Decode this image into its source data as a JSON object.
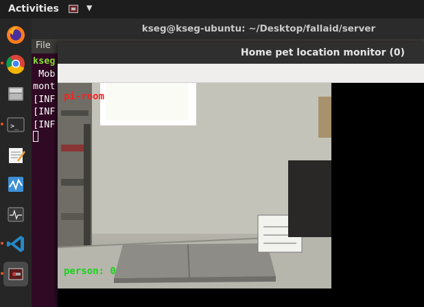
{
  "topbar": {
    "activities": "Activities",
    "app_icon": "window-app-icon",
    "menu_icon": "caret-down-icon"
  },
  "dock": {
    "items": [
      {
        "name": "firefox-icon",
        "running": false
      },
      {
        "name": "chrome-icon",
        "running": true
      },
      {
        "name": "files-icon",
        "running": false
      },
      {
        "name": "terminal-icon",
        "running": true
      },
      {
        "name": "text-editor-icon",
        "running": false
      },
      {
        "name": "system-monitor-icon",
        "running": false
      },
      {
        "name": "waveform-icon",
        "running": false
      },
      {
        "name": "vscode-icon",
        "running": true
      },
      {
        "name": "pet-monitor-app-icon",
        "running": true,
        "active": true
      }
    ]
  },
  "terminal": {
    "title": "kseg@kseg-ubuntu: ~/Desktop/fallaid/server",
    "menu_file": "File",
    "lines": [
      "kseg",
      " Mob",
      "mont",
      "[INF",
      "[INF",
      "[INF"
    ]
  },
  "monitor": {
    "title": "Home pet location monitor (0)",
    "overlay": {
      "room": "pi-room",
      "person": "person: 0"
    }
  },
  "colors": {
    "accent": "#e95420",
    "room_label": "#ff1f1f",
    "person_label": "#17d417"
  }
}
